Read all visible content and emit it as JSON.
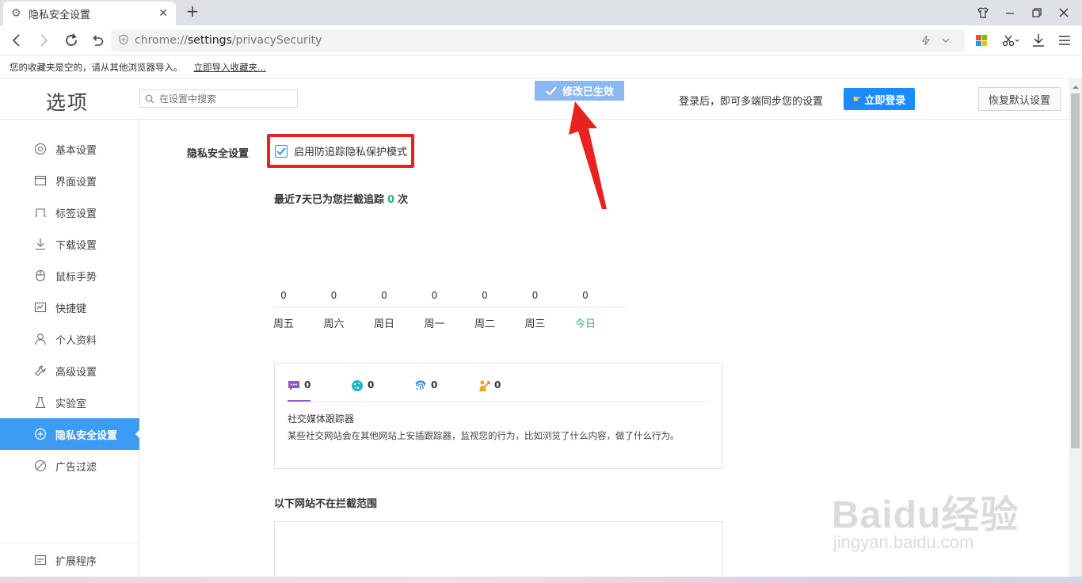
{
  "browser": {
    "tab_title": "隐私安全设置",
    "url_scheme": "chrome://",
    "url_host": "settings",
    "url_path": "/privacySecurity"
  },
  "bookmarks": {
    "empty_message": "您的收藏夹是空的，请从其他浏览器导入。",
    "import_link": "立即导入收藏夹..."
  },
  "header": {
    "title": "选项",
    "search_placeholder": "在设置中搜索",
    "toast": "修改已生效",
    "sync_text": "登录后，即可多端同步您的设置",
    "login_button": "立即登录",
    "reset_button": "恢复默认设置"
  },
  "sidebar": {
    "items": [
      {
        "label": "基本设置",
        "icon": "settings-circle-icon"
      },
      {
        "label": "界面设置",
        "icon": "window-icon"
      },
      {
        "label": "标签设置",
        "icon": "tab-icon"
      },
      {
        "label": "下载设置",
        "icon": "download-icon"
      },
      {
        "label": "鼠标手势",
        "icon": "mouse-icon"
      },
      {
        "label": "快捷键",
        "icon": "shortcut-icon"
      },
      {
        "label": "个人资料",
        "icon": "person-icon"
      },
      {
        "label": "高级设置",
        "icon": "wrench-icon"
      },
      {
        "label": "实验室",
        "icon": "flask-icon"
      },
      {
        "label": "隐私安全设置",
        "icon": "shield-plus-icon"
      },
      {
        "label": "广告过滤",
        "icon": "block-icon"
      }
    ],
    "active_index": 9,
    "footer_label": "扩展程序"
  },
  "privacy": {
    "section_label": "隐私安全设置",
    "checkbox_label": "启用防追踪隐私保护模式",
    "checkbox_checked": true,
    "stats_prefix": "最近7天已为您拦截追踪",
    "stats_count": "0",
    "stats_suffix": "次"
  },
  "chart_data": {
    "type": "bar",
    "categories": [
      "周五",
      "周六",
      "周日",
      "周一",
      "周二",
      "周三",
      "今日"
    ],
    "values": [
      0,
      0,
      0,
      0,
      0,
      0,
      0
    ],
    "highlight_category": "今日",
    "highlight_color": "#2db66f"
  },
  "trackers": {
    "tabs": [
      {
        "icon": "chat-bubble-icon",
        "count": "0",
        "color": "#8e58c7"
      },
      {
        "icon": "cookie-icon",
        "count": "0",
        "color": "#1fb3c4"
      },
      {
        "icon": "fingerprint-icon",
        "count": "0",
        "color": "#2f86e8"
      },
      {
        "icon": "crypto-miner-icon",
        "count": "0",
        "color": "#f0a030"
      }
    ],
    "active_tab": 0,
    "active_name": "社交媒体跟踪器",
    "active_description": "某些社交网站会在其他网站上安插跟踪器，监视您的行为，比如浏览了什么内容，做了什么行为。"
  },
  "whitelist": {
    "title": "以下网站不在拦截范围"
  },
  "watermark": {
    "main": "Baidu经验",
    "sub": "jingyan.baidu.com"
  },
  "colors": {
    "accent": "#3c9cf5",
    "login": "#1a8cff",
    "annotation": "#e8231f",
    "success": "#2db66f"
  }
}
